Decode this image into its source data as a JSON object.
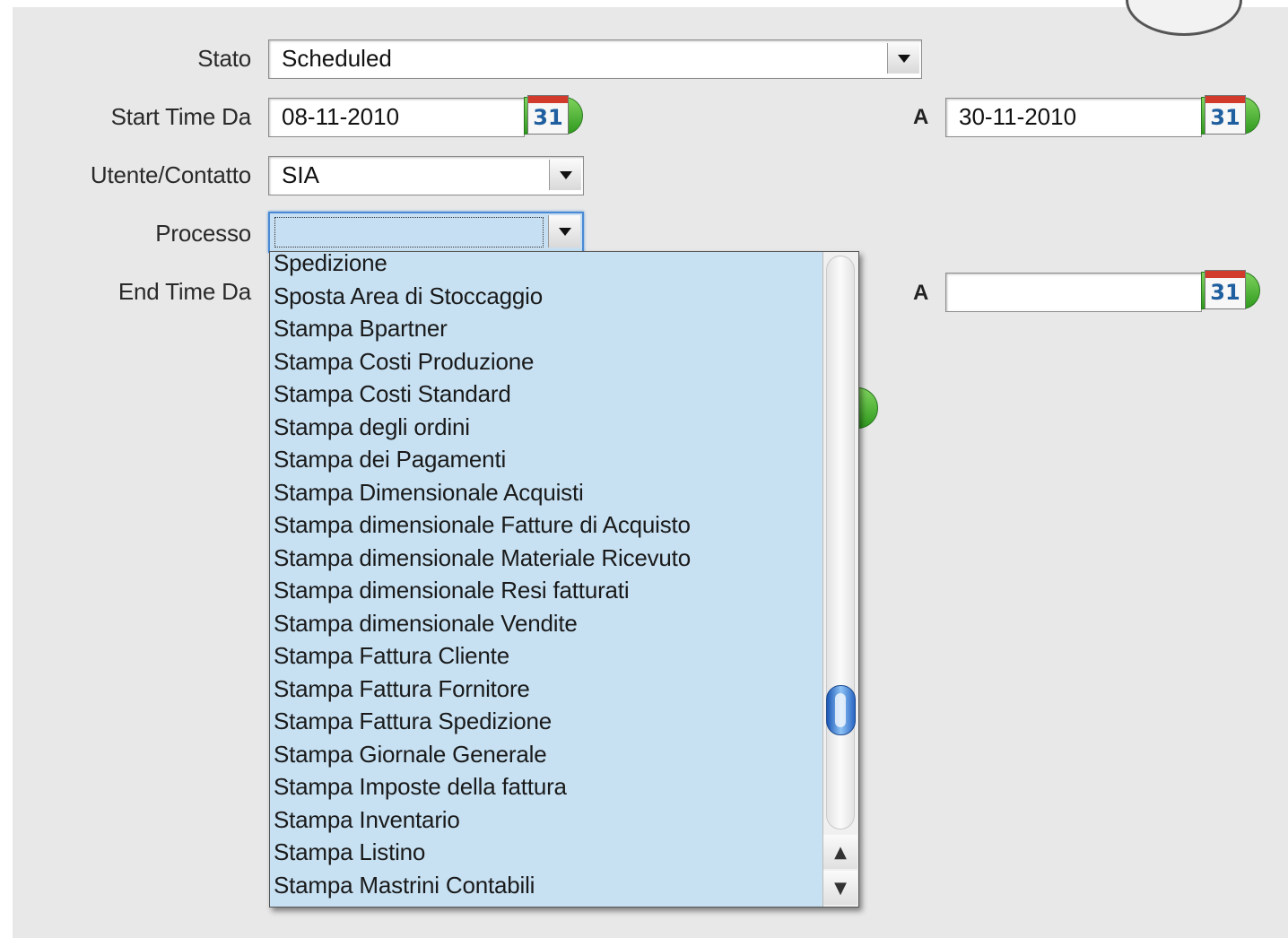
{
  "labels": {
    "stato": "Stato",
    "start_time_da": "Start Time Da",
    "start_time_a": "A",
    "utente_contatto": "Utente/Contatto",
    "processo": "Processo",
    "end_time_da": "End Time Da",
    "end_time_a": "A"
  },
  "fields": {
    "stato_value": "Scheduled",
    "start_time_from": "08-11-2010",
    "start_time_to": "30-11-2010",
    "utente_contatto_value": "SIA",
    "processo_value": "",
    "end_time_to": ""
  },
  "calendar_icon_text": "31",
  "processo_options": [
    "Spedizione",
    "Sposta Area di Stoccaggio",
    "Stampa Bpartner",
    "Stampa Costi Produzione",
    "Stampa Costi Standard",
    "Stampa degli ordini",
    "Stampa dei Pagamenti",
    "Stampa Dimensionale Acquisti",
    "Stampa dimensionale Fatture di Acquisto",
    "Stampa dimensionale Materiale Ricevuto",
    "Stampa dimensionale Resi fatturati",
    "Stampa dimensionale Vendite",
    "Stampa Fattura Cliente",
    "Stampa Fattura Fornitore",
    "Stampa Fattura Spedizione",
    "Stampa Giornale Generale",
    "Stampa Imposte della fattura",
    "Stampa Inventario",
    "Stampa Listino",
    "Stampa Mastrini Contabili"
  ],
  "scroll_position_fraction": 0.82,
  "icons": {
    "calendar": "calendar-icon",
    "dropdown_arrow": "chevron-down-icon",
    "scroll_up": "▲",
    "scroll_down": "▼"
  }
}
